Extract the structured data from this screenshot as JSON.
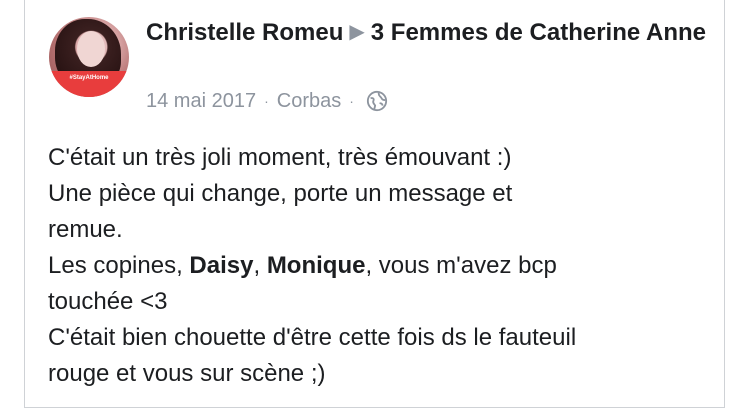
{
  "post": {
    "author": "Christelle Romeu",
    "arrow": "▶",
    "target": "3 Femmes de Catherine Anne",
    "date": "14 mai 2017",
    "separator": "·",
    "location": "Corbas",
    "privacy_icon": "globe-icon",
    "avatar_banner": "#StayAtHome",
    "lines": {
      "l1": "C'était un très joli moment, très émouvant :)",
      "l2": "Une pièce qui change, porte un message et",
      "l3": "remue.",
      "l4_pre": "Les copines, ",
      "l4_name1": "Daisy",
      "l4_mid": ", ",
      "l4_name2": "Monique",
      "l4_post": ", vous m'avez bcp",
      "l5": "touchée <3",
      "l6": "C'était bien chouette d'être cette fois ds le fauteuil",
      "l7": "rouge et vous sur scène ;)"
    }
  },
  "colors": {
    "text": "#1c1e21",
    "meta": "#8d949e",
    "border": "#cfd2d6",
    "avatar_banner": "#e83d3d"
  }
}
